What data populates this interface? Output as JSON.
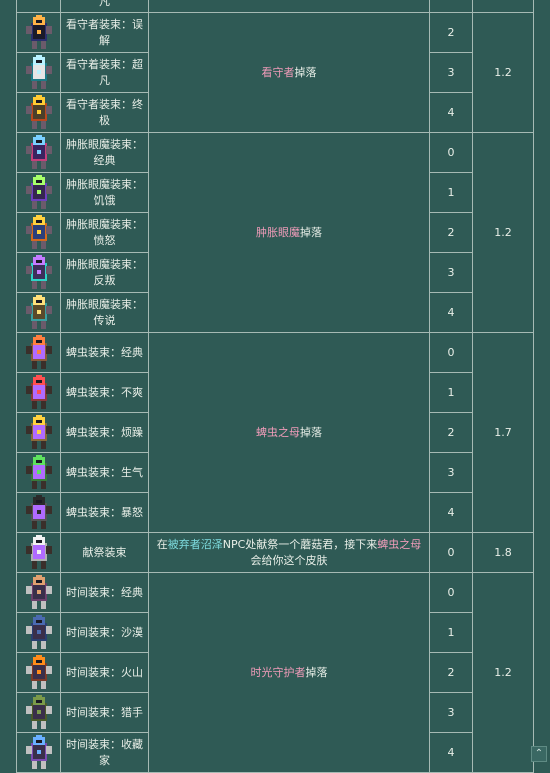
{
  "sprite_colors": [
    [
      "#ffb347",
      "#2a2f6e",
      "#1a1a2a",
      "#6b5b6b"
    ],
    [
      "#b9f2ff",
      "#1d7a86",
      "#e5e5e5",
      "#6b5b6b"
    ],
    [
      "#ffcc33",
      "#b8471f",
      "#4a3f2a",
      "#6b5b6b"
    ],
    [
      "#7ad0ff",
      "#c53f7a",
      "#3b2460",
      "#6b5b6b"
    ],
    [
      "#a7ff6a",
      "#6e3fbf",
      "#352750",
      "#6b5b6b"
    ],
    [
      "#ffd23f",
      "#d2691e",
      "#2b3f7a",
      "#6b5b6b"
    ],
    [
      "#c57bff",
      "#2fd3c7",
      "#3d2f5a",
      "#6b5b6b"
    ],
    [
      "#ffe07a",
      "#3aa0a0",
      "#5a4a2a",
      "#6b5b6b"
    ],
    [
      "#ff7f3f",
      "#8a5a3a",
      "#b06bff",
      "#3a2f2a"
    ],
    [
      "#ff5050",
      "#8a3a3a",
      "#b06bff",
      "#3a2f2a"
    ],
    [
      "#ffd23f",
      "#8a6a3a",
      "#b06bff",
      "#3a2f2a"
    ],
    [
      "#5fe35f",
      "#3a7a3a",
      "#b06bff",
      "#3a2f2a"
    ],
    [
      "#2a2a2a",
      "#555555",
      "#b06bff",
      "#3a2f2a"
    ],
    [
      "#f2f2f2",
      "#b0b0b0",
      "#b06bff",
      "#3a2f2a"
    ],
    [
      "#e0a070",
      "#6b3f6b",
      "#3a2f4a",
      "#c0c0c0"
    ],
    [
      "#4a6ab0",
      "#2a3f70",
      "#3a2f4a",
      "#c0c0c0"
    ],
    [
      "#ff8c1a",
      "#7a3a2a",
      "#3a2f4a",
      "#c0c0c0"
    ],
    [
      "#7a9a4a",
      "#4a5a2a",
      "#3a2f4a",
      "#c0c0c0"
    ],
    [
      "#6ab0ff",
      "#7a4ab0",
      "#3a2f4a",
      "#c0c0c0"
    ]
  ],
  "rows": [
    {
      "name": "",
      "level": "",
      "rate": ""
    },
    {
      "name": "看守者装束：误解",
      "level": "2",
      "rate": "1.2",
      "source": [
        "看守者",
        "掉落"
      ]
    },
    {
      "name": "看守着装束：超凡",
      "level": "3"
    },
    {
      "name": "看守者装束：终极",
      "level": "4"
    },
    {
      "name": "肿胀眼魔装束：经典",
      "level": "0"
    },
    {
      "name": "肿胀眼魔装束：饥饿",
      "level": "1"
    },
    {
      "name": "肿胀眼魔装束：愤怒",
      "level": "2",
      "rate": "1.2",
      "source": [
        "肿胀眼魔",
        "掉落"
      ]
    },
    {
      "name": "肿胀眼魔装束：反叛",
      "level": "3"
    },
    {
      "name": "肿胀眼魔装束：传说",
      "level": "4"
    },
    {
      "name": "蜱虫装束：经典",
      "level": "0"
    },
    {
      "name": "蜱虫装束：不爽",
      "level": "1"
    },
    {
      "name": "蜱虫装束：烦躁",
      "level": "2",
      "rate": "1.7",
      "source": [
        "蜱虫之母",
        "掉落"
      ]
    },
    {
      "name": "蜱虫装束：生气",
      "level": "3"
    },
    {
      "name": "蜱虫装束：暴怒",
      "level": "4"
    },
    {
      "name": "献祭装束",
      "level": "0",
      "rate": "1.8"
    },
    {
      "name": "时间装束：经典",
      "level": "0"
    },
    {
      "name": "时间装束：沙漠",
      "level": "1"
    },
    {
      "name": "时间装束：火山",
      "level": "2",
      "rate": "1.2",
      "source": [
        "时光守护者",
        "掉落"
      ]
    },
    {
      "name": "时间装束：猎手",
      "level": "3"
    },
    {
      "name": "时间装束：收藏家",
      "level": "4"
    }
  ],
  "first_row_name_fragment": "凡",
  "sacrifice_source": {
    "p1": "在",
    "place": "被弃者沼泽",
    "p2": "NPC处献祭一个蘑菇君，接下来",
    "boss": "蜱虫之母",
    "p3": "会给你这个皮肤"
  },
  "scroll_icon": "chevron-up-icon",
  "scroll_glyph": "⌃"
}
